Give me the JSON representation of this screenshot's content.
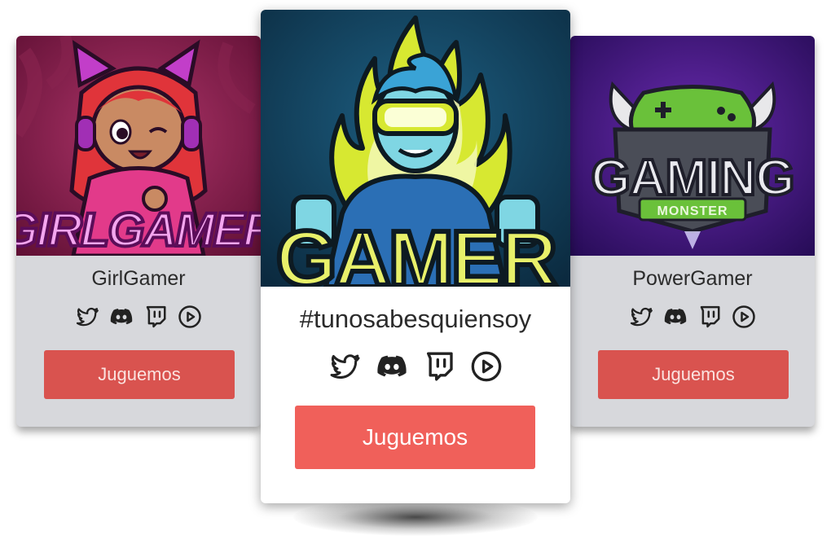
{
  "cards": [
    {
      "art_text": "GIRLGAMER",
      "name": "GirlGamer",
      "button_label": "Juguemos"
    },
    {
      "art_text": "GAMER",
      "name": "#tunosabesquiensoy",
      "button_label": "Juguemos"
    },
    {
      "art_text": "GAMING",
      "art_subtext": "MONSTER",
      "name": "PowerGamer",
      "button_label": "Juguemos"
    }
  ],
  "social_icons": [
    "twitter-icon",
    "discord-icon",
    "twitch-icon",
    "play-icon"
  ],
  "colors": {
    "button": "#d9534f",
    "button_featured": "#f0605a",
    "card_side_bg": "#d7d8dc",
    "card_featured_bg": "#ffffff",
    "text": "#2b2b2b"
  }
}
